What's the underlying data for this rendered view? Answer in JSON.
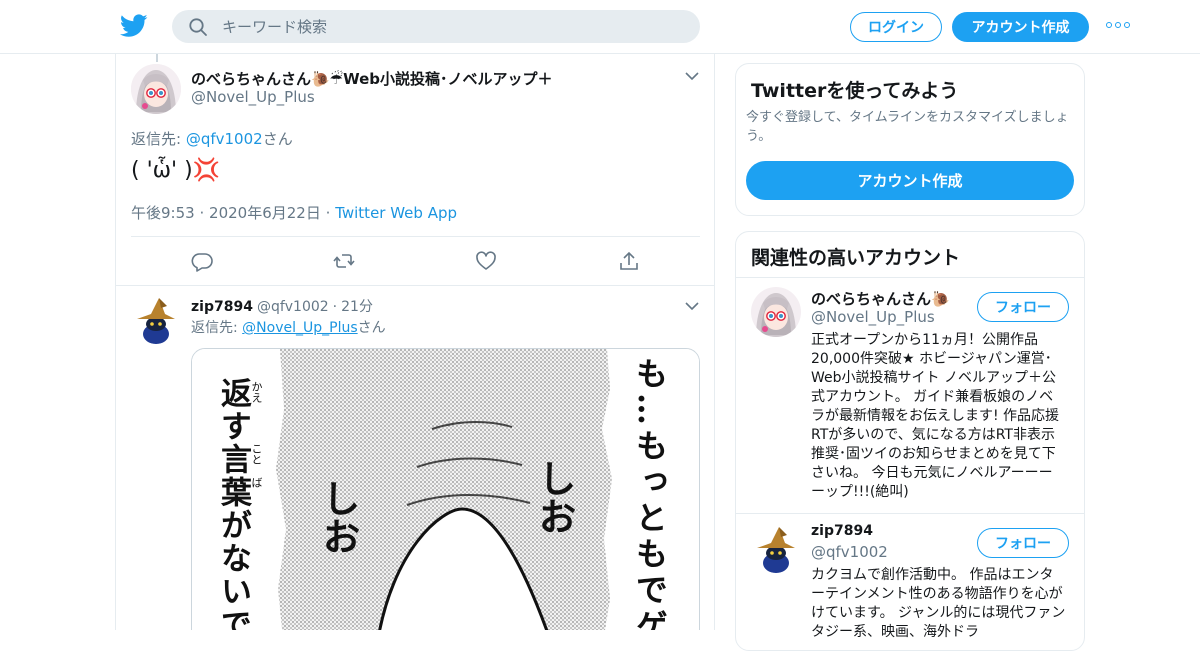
{
  "header": {
    "search_placeholder": "キーワード検索",
    "login_label": "ログイン",
    "signup_label": "アカウント作成"
  },
  "tweet_main": {
    "display_name": "のべらちゃんさん🐌☔Web小説投稿･ノベルアップ＋",
    "handle": "@Novel_Up_Plus",
    "reply_prefix": "返信先: ",
    "reply_handle": "@qfv1002",
    "reply_suffix": "さん",
    "text": "( 'ὧ' )💢",
    "time": "午後9:53",
    "date": "2020年6月22日",
    "source": "Twitter Web App"
  },
  "tweet_reply": {
    "display_name": "zip7894",
    "handle": "@qfv1002",
    "time_ago": "21分",
    "reply_prefix": "返信先: ",
    "reply_handle": "@Novel_Up_Plus",
    "reply_suffix": "さん",
    "media_text_left": "返す言葉がないで",
    "media_ruby_left_1": "かえ",
    "media_ruby_left_2": "こと",
    "media_ruby_left_3": "ば",
    "media_text_right": "も…もっともでゲ",
    "media_sfx_1": "しお",
    "media_sfx_2": "しお"
  },
  "sidebar": {
    "signup_card": {
      "title": "Twitterを使ってみよう",
      "subtitle": "今すぐ登録して、タイムラインをカスタマイズしましょう。",
      "button_label": "アカウント作成"
    },
    "related": {
      "title": "関連性の高いアカウント",
      "follow_label": "フォロー",
      "accounts": [
        {
          "name": "のべらちゃんさん🐌",
          "handle": "@Novel_Up_Plus",
          "bio": "正式オープンから11ヵ月！公開作品20,000件突破★ ホビージャパン運営･Web小説投稿サイト ノベルアップ＋公式アカウント。 ガイド兼看板娘のノベラが最新情報をお伝えします! 作品応援RTが多いので、気になる方はRT非表示推奨･固ツイのお知らせまとめを見て下さいね。 今日も元気にノベルアーーーーップ!!!(絶叫)"
        },
        {
          "name": "zip7894",
          "handle": "@qfv1002",
          "bio": "カクヨムで創作活動中。 作品はエンターテインメント性のある物語作りを心がけています。 ジャンル的には現代ファンタジー系、映画、海外ドラ"
        }
      ]
    }
  },
  "colors": {
    "accent": "#1da1f2",
    "link": "#1b95e0",
    "text": "#14171a",
    "muted": "#657786",
    "border": "#e6ecf0"
  },
  "icons": [
    "twitter-bird-icon",
    "search-icon",
    "more-icon",
    "chevron-down-icon",
    "reply-icon",
    "retweet-icon",
    "like-icon",
    "share-icon"
  ]
}
